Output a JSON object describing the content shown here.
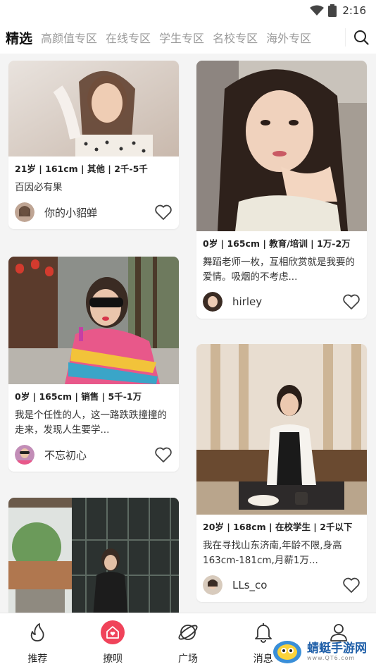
{
  "status": {
    "time": "2:16"
  },
  "tabs": [
    "精选",
    "高颜值专区",
    "在线专区",
    "学生专区",
    "名校专区",
    "海外专区"
  ],
  "cards": [
    {
      "meta": "21岁 | 161cm | 其他 | 2千-5千",
      "desc": "百因必有果",
      "username": "你的小貂蝉"
    },
    {
      "meta": "0岁 | 165cm | 销售 | 5千-1万",
      "desc": "我是个任性的人，这一路跌跌撞撞的走来，发现人生要学...",
      "username": "不忘初心"
    },
    {
      "meta": "0岁 | 165cm | 教育/培训 | 1万-2万",
      "desc": "舞蹈老师一枚，互相欣赏就是我要的爱情。吸烟的不考虑...",
      "username": "hirley"
    },
    {
      "meta": "20岁 | 168cm | 在校学生 | 2千以下",
      "desc": "我在寻找山东济南,年龄不限,身高163cm-181cm,月薪1万...",
      "username": "LLs_co"
    }
  ],
  "nav": [
    {
      "label": "推荐",
      "icon": "flame-icon"
    },
    {
      "label": "撩呗",
      "icon": "home-heart-icon"
    },
    {
      "label": "广场",
      "icon": "planet-icon"
    },
    {
      "label": "消息",
      "icon": "bell-icon"
    },
    {
      "label": "",
      "icon": "user-icon"
    }
  ],
  "watermark": {
    "text": "蜻蜓手游网",
    "sub": "www.QT6.com"
  }
}
